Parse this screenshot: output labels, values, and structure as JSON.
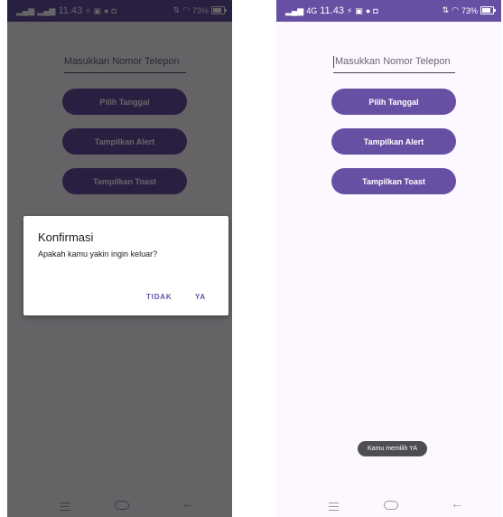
{
  "status_bar": {
    "signal": "⸴⸴",
    "time": "11.43",
    "icons": [
      "bolt-icon",
      "gallery-icon",
      "chat-icon",
      "message-icon"
    ],
    "battery": "73%",
    "network": "4G"
  },
  "form": {
    "phone_placeholder": "Masukkan Nomor Telepon",
    "buttons": {
      "pick_date": "Pilih Tanggal",
      "show_alert": "Tampilkan Alert",
      "show_toast": "Tampilkan Toast"
    }
  },
  "dialog": {
    "title": "Konfirmasi",
    "message": "Apakah kamu yakin ingin keluar?",
    "negative": "TIDAK",
    "positive": "YA"
  },
  "toast": {
    "message": "Kamu memilih YA"
  },
  "colors": {
    "primary": "#6750a4",
    "background": "#fdf7ff",
    "scrim": "#000000",
    "toast": "#4f4d54"
  }
}
